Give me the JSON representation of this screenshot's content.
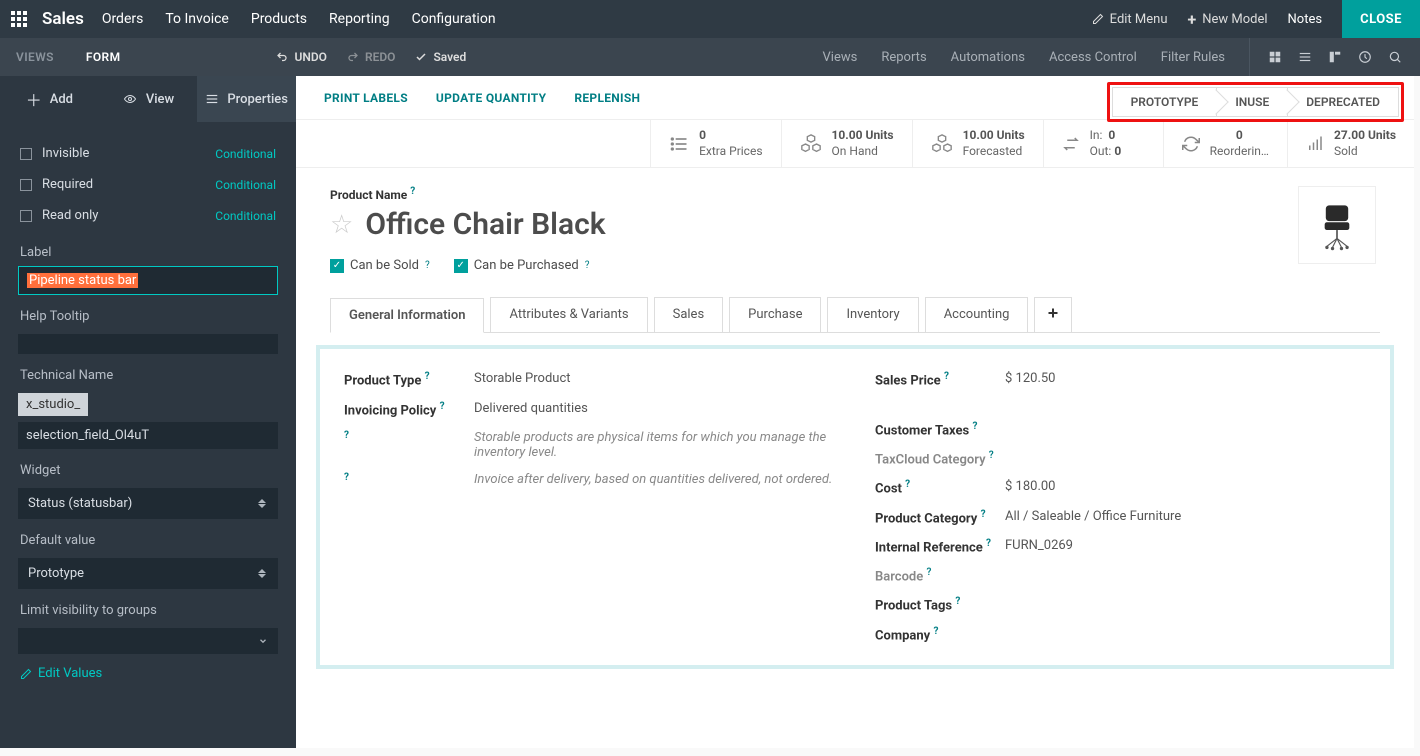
{
  "topnav": {
    "brand": "Sales",
    "items": [
      "Orders",
      "To Invoice",
      "Products",
      "Reporting",
      "Configuration"
    ],
    "edit_menu": "Edit Menu",
    "new_model": "New Model",
    "notes": "Notes",
    "close": "CLOSE"
  },
  "secondbar": {
    "views": "VIEWS",
    "form": "FORM",
    "undo": "UNDO",
    "redo": "REDO",
    "saved": "Saved",
    "right": [
      "Views",
      "Reports",
      "Automations",
      "Access Control",
      "Filter Rules"
    ]
  },
  "studio": {
    "tabs": {
      "add": "Add",
      "view": "View",
      "properties": "Properties"
    },
    "invisible": "Invisible",
    "required": "Required",
    "readonly": "Read only",
    "conditional": "Conditional",
    "label_label": "Label",
    "label_value": "Pipeline status bar",
    "help_tooltip": "Help Tooltip",
    "technical_name": "Technical Name",
    "tech_prefix": "x_studio_",
    "tech_value": "selection_field_Ol4uT",
    "widget_label": "Widget",
    "widget_value": "Status (statusbar)",
    "default_label": "Default value",
    "default_value": "Prototype",
    "limit_label": "Limit visibility to groups",
    "edit_values": "Edit Values"
  },
  "actions": {
    "print_labels": "PRINT LABELS",
    "update_qty": "UPDATE QUANTITY",
    "replenish": "REPLENISH"
  },
  "pipeline": [
    "PROTOTYPE",
    "INUSE",
    "DEPRECATED"
  ],
  "stats": {
    "extra_prices": {
      "n": "0",
      "label": "Extra Prices"
    },
    "on_hand": {
      "n": "10.00 Units",
      "label": "On Hand"
    },
    "forecasted": {
      "n": "10.00 Units",
      "label": "Forecasted"
    },
    "in": "In:",
    "in_v": "0",
    "out": "Out:",
    "out_v": "0",
    "reordering": {
      "n": "0",
      "label": "Reorderin…"
    },
    "sold": {
      "n": "27.00 Units",
      "label": "Sold"
    }
  },
  "product": {
    "name_label": "Product Name",
    "name": "Office Chair Black",
    "can_be_sold": "Can be Sold",
    "can_be_purchased": "Can be Purchased"
  },
  "tabs": [
    "General Information",
    "Attributes & Variants",
    "Sales",
    "Purchase",
    "Inventory",
    "Accounting"
  ],
  "form": {
    "product_type_l": "Product Type",
    "product_type_v": "Storable Product",
    "invoicing_l": "Invoicing Policy",
    "invoicing_v": "Delivered quantities",
    "help1": "Storable products are physical items for which you manage the inventory level.",
    "help2": "Invoice after delivery, based on quantities delivered, not ordered.",
    "sales_price_l": "Sales Price",
    "sales_price_v": "$ 120.50",
    "customer_taxes_l": "Customer Taxes",
    "taxcloud_l": "TaxCloud Category",
    "cost_l": "Cost",
    "cost_v": "$ 180.00",
    "category_l": "Product Category",
    "category_v": "All / Saleable / Office Furniture",
    "internal_ref_l": "Internal Reference",
    "internal_ref_v": "FURN_0269",
    "barcode_l": "Barcode",
    "tags_l": "Product Tags",
    "company_l": "Company"
  }
}
